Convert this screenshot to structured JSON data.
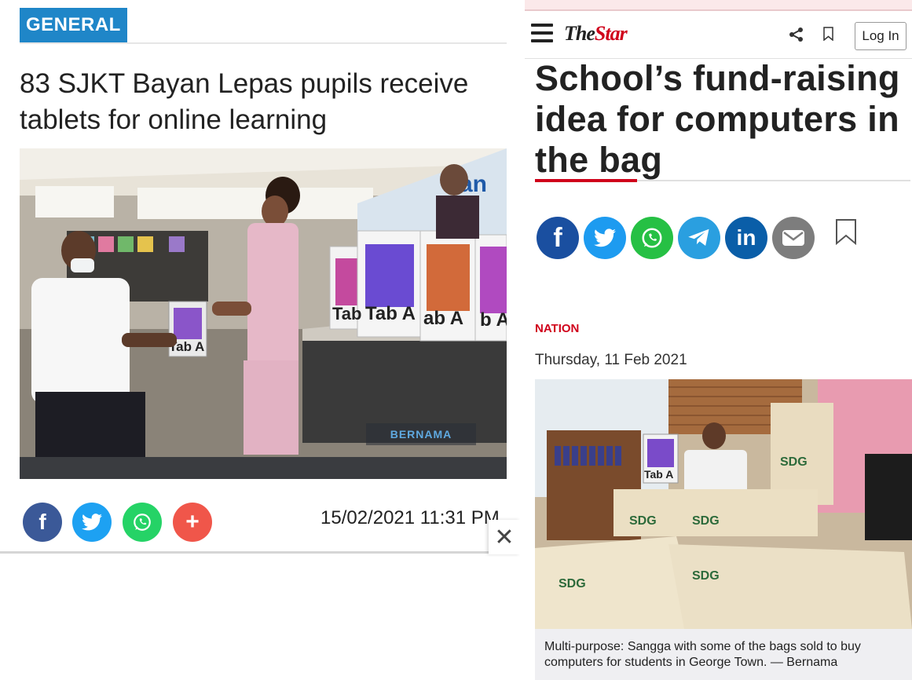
{
  "left": {
    "category": "GENERAL",
    "title": "83 SJKT Bayan Lepas pupils receive tablets for online learning",
    "photo_watermark": "BERNAMA",
    "photo_box_text": "Tab A",
    "datetime": "15/02/2021 11:31 PM",
    "share": [
      {
        "icon": "facebook-icon",
        "glyph": "f",
        "color": "#3b5998"
      },
      {
        "icon": "twitter-icon",
        "glyph": "",
        "color": "#1da1f2"
      },
      {
        "icon": "whatsapp-icon",
        "glyph": "",
        "color": "#25d366"
      },
      {
        "icon": "plus-icon",
        "glyph": "+",
        "color": "#f0564a"
      }
    ],
    "close_glyph": "✕"
  },
  "right": {
    "logo_the": "The",
    "logo_star": "Star",
    "login_label": "Log In",
    "title": "School’s fund-raising idea for computers in the bag",
    "share": [
      {
        "icon": "facebook-icon",
        "glyph": "f",
        "color": "#1a4fa0"
      },
      {
        "icon": "twitter-icon",
        "glyph": "",
        "color": "#1d9bf0"
      },
      {
        "icon": "whatsapp-icon",
        "glyph": "",
        "color": "#26c044"
      },
      {
        "icon": "telegram-icon",
        "glyph": "",
        "color": "#2a9fe0"
      },
      {
        "icon": "linkedin-icon",
        "glyph": "in",
        "color": "#0a5ea8"
      },
      {
        "icon": "email-icon",
        "glyph": "",
        "color": "#7d7d7d"
      }
    ],
    "section": "NATION",
    "date": "Thursday, 11 Feb 2021",
    "photo_bag_text": "SDG",
    "photo_box_text": "Tab A",
    "caption": "Multi-purpose: Sangga with some of the bags sold to buy computers for students in George Town. — Bernama"
  },
  "colors": {
    "general_badge": "#1f86c8",
    "star_red": "#d0021b"
  }
}
